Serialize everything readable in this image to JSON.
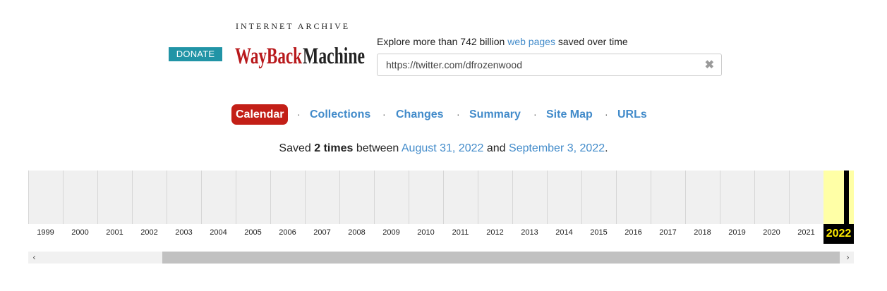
{
  "header": {
    "donate_label": "DONATE",
    "ia_title": "INTERNET ARCHIVE",
    "logo_text": "WayBackMachine",
    "explore_prefix": "Explore more than 742 billion ",
    "explore_link": "web pages",
    "explore_suffix": " saved over time",
    "url_value": "https://twitter.com/dfrozenwood",
    "clear_icon": "✖"
  },
  "nav": {
    "tabs": [
      {
        "label": "Calendar",
        "active": true
      },
      {
        "label": "Collections",
        "active": false
      },
      {
        "label": "Changes",
        "active": false
      },
      {
        "label": "Summary",
        "active": false
      },
      {
        "label": "Site Map",
        "active": false
      },
      {
        "label": "URLs",
        "active": false
      }
    ],
    "separator": "·"
  },
  "saved": {
    "prefix": "Saved ",
    "count": "2 times",
    "middle": " between ",
    "start_date": "August 31, 2022",
    "and": " and ",
    "end_date": "September 3, 2022",
    "suffix": "."
  },
  "timeline": {
    "years": [
      "1999",
      "2000",
      "2001",
      "2002",
      "2003",
      "2004",
      "2005",
      "2006",
      "2007",
      "2008",
      "2009",
      "2010",
      "2011",
      "2012",
      "2013",
      "2014",
      "2015",
      "2016",
      "2017",
      "2018",
      "2019",
      "2020",
      "2021",
      "2022"
    ],
    "active_year": "2022",
    "highlight_color": "#ffffa6",
    "capture_month_fraction": 0.67
  },
  "scrollbar": {
    "left_icon": "‹",
    "right_icon": "›"
  },
  "colors": {
    "accent_link": "#428bca",
    "active_tab": "#c31f17",
    "donate": "#2194a6",
    "year_active_text": "#ffeb00"
  }
}
